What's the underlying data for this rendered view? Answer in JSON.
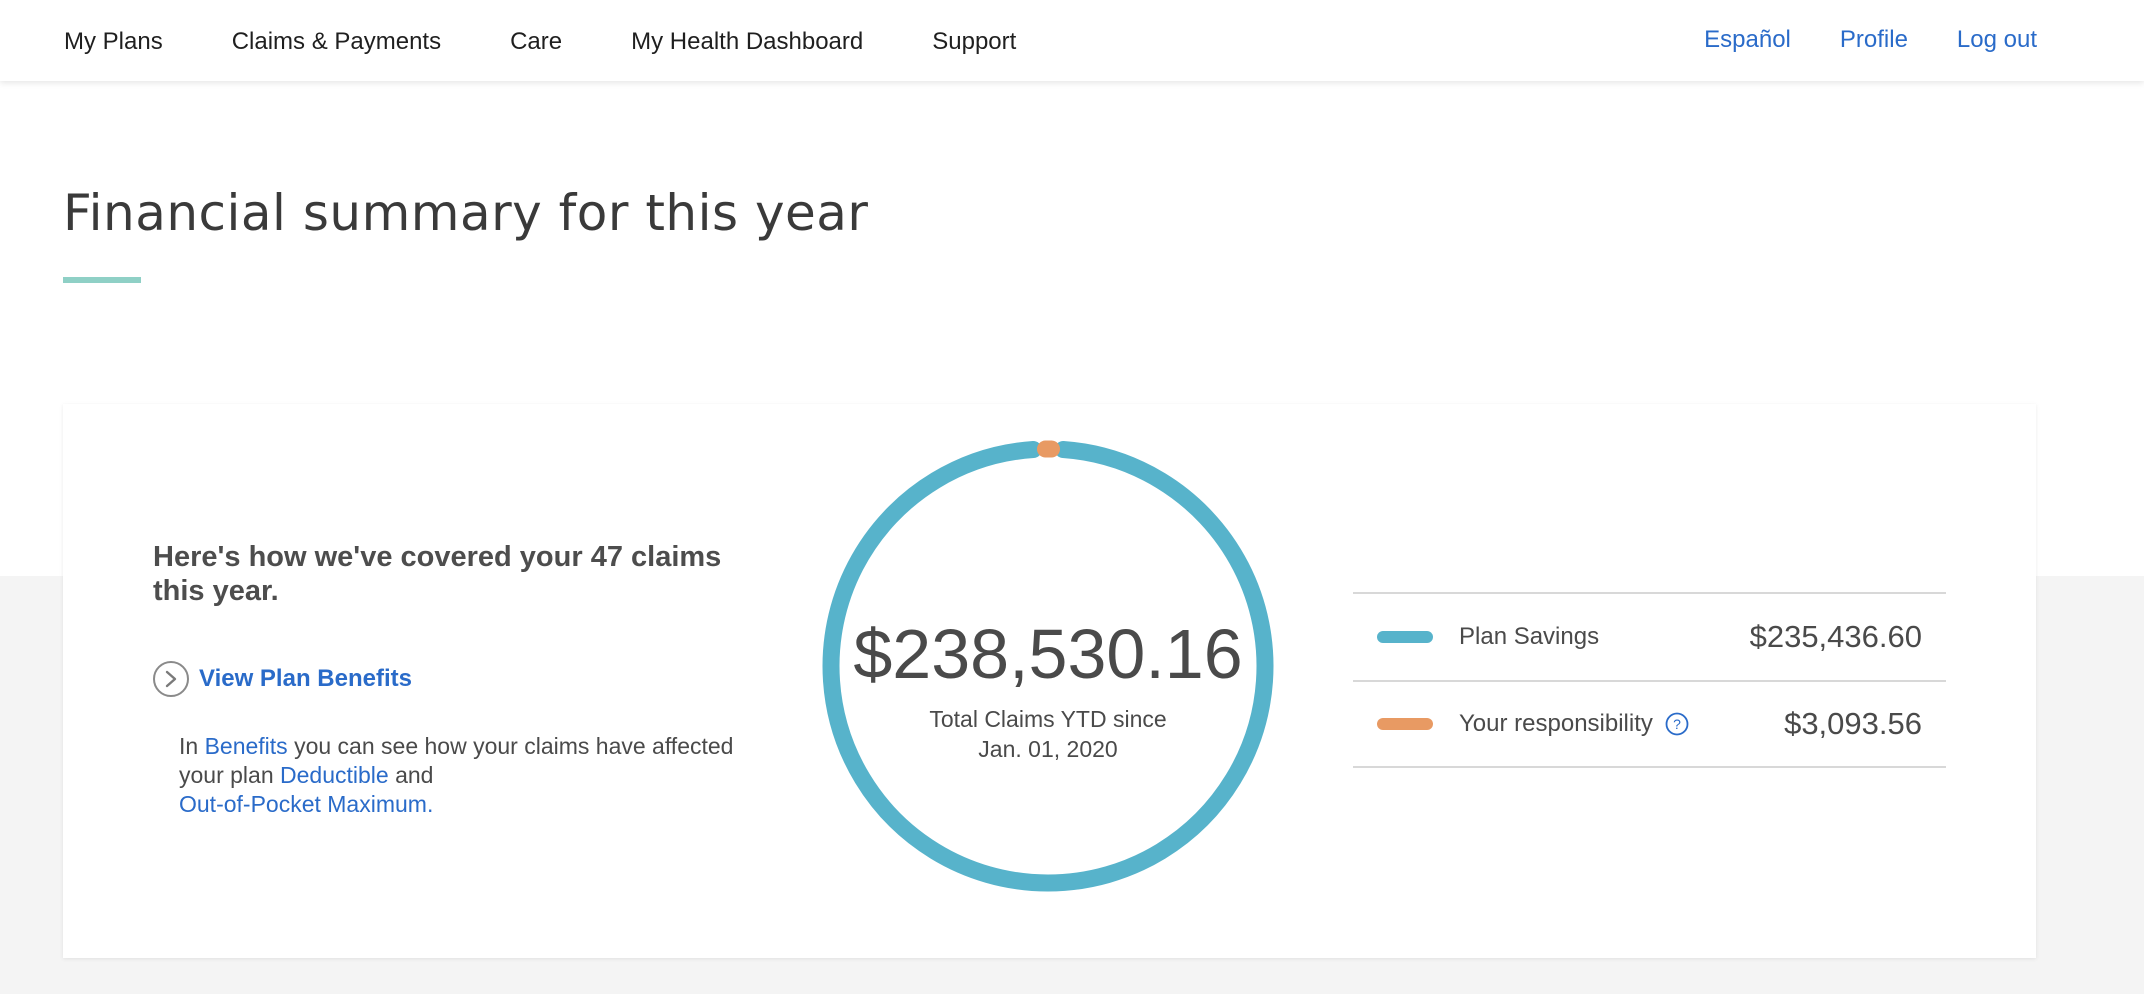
{
  "nav": {
    "items": [
      {
        "label": "My Plans"
      },
      {
        "label": "Claims & Payments"
      },
      {
        "label": "Care"
      },
      {
        "label": "My Health Dashboard"
      },
      {
        "label": "Support"
      }
    ],
    "right": [
      {
        "label": "Español"
      },
      {
        "label": "Profile"
      },
      {
        "label": "Log out"
      }
    ]
  },
  "page": {
    "title": "Financial summary for this year"
  },
  "summary": {
    "headline": "Here's how we've covered your 47 claims this year.",
    "view_link": "View Plan Benefits",
    "desc_prefix": "In ",
    "desc_link_benefits": "Benefits",
    "desc_mid": " you can see how your claims have affected your plan ",
    "desc_link_deductible": "Deductible",
    "desc_and": " and ",
    "desc_link_oop": "Out-of-Pocket Maximum.",
    "total_amount": "$238,530.16",
    "total_label_line1": "Total Claims YTD since",
    "total_label_line2": "Jan. 01, 2020",
    "legend": [
      {
        "label": "Plan Savings",
        "value": "$235,436.60",
        "color": "#57b3cb"
      },
      {
        "label": "Your responsibility",
        "value": "$3,093.56",
        "color": "#e89a63"
      }
    ]
  },
  "chart_data": {
    "type": "pie",
    "categories": [
      "Plan Savings",
      "Your responsibility"
    ],
    "values": [
      235436.6,
      3093.56
    ],
    "colors": [
      "#57b3cb",
      "#e89a63"
    ]
  },
  "colors": {
    "link": "#2a6bc9",
    "accent_rule": "#8fd0c6",
    "savings": "#57b3cb",
    "responsibility": "#e89a63"
  },
  "icons": {
    "view_link": "chevron-right-circle-icon",
    "help": "question-circle-icon"
  }
}
